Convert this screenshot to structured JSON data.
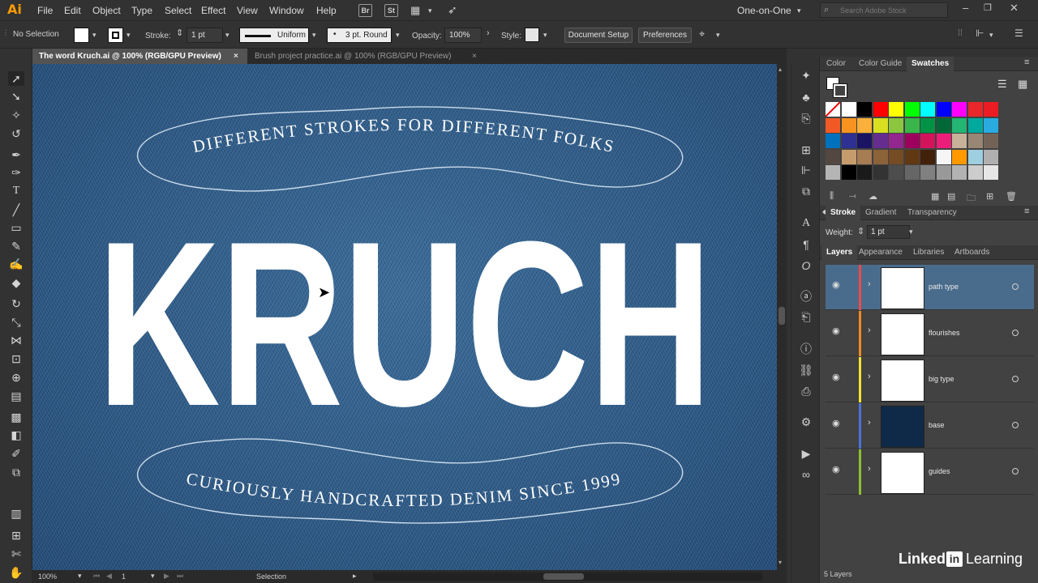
{
  "app": {
    "logo": "Ai",
    "menus": [
      "File",
      "Edit",
      "Object",
      "Type",
      "Select",
      "Effect",
      "View",
      "Window",
      "Help"
    ],
    "bridge_icon": "Br",
    "stock_icon": "St",
    "workspace": "One-on-One",
    "search_placeholder": "Search Adobe Stock"
  },
  "control_bar": {
    "selection": "No Selection",
    "stroke_label": "Stroke:",
    "stroke_value": "1 pt",
    "stroke_profile": "Uniform",
    "brush": "3 pt. Round",
    "opacity_label": "Opacity:",
    "opacity_value": "100%",
    "style_label": "Style:",
    "doc_setup": "Document Setup",
    "preferences": "Preferences"
  },
  "tabs": [
    {
      "label": "The word Kruch.ai @ 100% (RGB/GPU Preview)",
      "active": true
    },
    {
      "label": "Brush project practice.ai @ 100% (RGB/GPU Preview)",
      "active": false
    }
  ],
  "artwork": {
    "top_text": "DIFFERENT STROKES FOR DIFFERENT FOLKS",
    "big_text": "KRUCH",
    "bottom_text": "CURIOUSLY HANDCRAFTED DENIM SINCE 1999"
  },
  "status": {
    "zoom": "100%",
    "page": "1",
    "tool": "Selection"
  },
  "swatches_panel": {
    "tabs": [
      "Color",
      "Color Guide",
      "Swatches"
    ],
    "active_tab": "Swatches",
    "colors": [
      [
        "#ffffff",
        "#ffffff",
        "#000000",
        "#ff0000",
        "#ffff00",
        "#00ff00",
        "#00ffff",
        "#0000ff",
        "#ff00ff",
        "#e8272a",
        "#ec1c24"
      ],
      [
        "#f15a24",
        "#f7931e",
        "#fbb03b",
        "#d9e021",
        "#8cc63f",
        "#39b54a",
        "#009245",
        "#006837",
        "#22b573",
        "#00a99d",
        "#29abe2"
      ],
      [
        "#0071bc",
        "#2e3192",
        "#1b1464",
        "#662d91",
        "#93278f",
        "#9e005d",
        "#d4145a",
        "#ed1e79",
        "#c7b299",
        "#998675",
        "#736357"
      ],
      [
        "#534741",
        "#c69c6d",
        "#a67c52",
        "#8c6239",
        "#754c24",
        "#603813",
        "#42210b",
        "#f5f5f5",
        "#ff9900",
        "#9ecfe0",
        "#b0b0b0"
      ],
      [
        "#b5b5b5",
        "#000000",
        "#1a1a1a",
        "#333333",
        "#4d4d4d",
        "#666666",
        "#808080",
        "#999999",
        "#b3b3b3",
        "#cccccc",
        "#e6e6e6"
      ]
    ]
  },
  "stroke_panel": {
    "tabs": [
      "Stroke",
      "Gradient",
      "Transparency"
    ],
    "weight_label": "Weight:",
    "weight_value": "1 pt"
  },
  "layers_panel": {
    "tabs": [
      "Layers",
      "Appearance",
      "Libraries",
      "Artboards"
    ],
    "layers": [
      {
        "name": "path type",
        "color": "#e94b4b",
        "selected": true,
        "thumb": "#ffffff"
      },
      {
        "name": "flourishes",
        "color": "#f08a1c",
        "selected": false,
        "thumb": "#ffffff"
      },
      {
        "name": "big type",
        "color": "#f4e331",
        "selected": false,
        "thumb": "#ffffff"
      },
      {
        "name": "base",
        "color": "#4b72d9",
        "selected": false,
        "thumb": "#0e2a48"
      },
      {
        "name": "guides",
        "color": "#8fbf2f",
        "selected": false,
        "thumb": "#ffffff"
      }
    ],
    "count": "5 Layers"
  },
  "watermark": {
    "brand": "Linked",
    "badge": "in",
    "suffix": "Learning"
  }
}
